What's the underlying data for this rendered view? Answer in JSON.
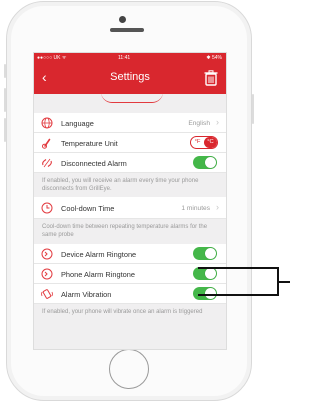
{
  "status": {
    "carrier": "●●○○○ UK  ᯤ",
    "time": "11:41",
    "battery": "✱ 54%"
  },
  "nav": {
    "title": "Settings",
    "back_icon": "chevron-left-icon",
    "action_icon": "trash-icon"
  },
  "settings": {
    "language": {
      "label": "Language",
      "value": "English"
    },
    "temperature_unit": {
      "label": "Temperature Unit",
      "options": [
        "°F",
        "°C"
      ],
      "selected": "°C"
    },
    "disconnected_alarm": {
      "label": "Disconnected Alarm",
      "on": true
    },
    "disconnected_note": "If enabled, you will receive an alarm every time your phone disconnects from GrillEye.",
    "cooldown": {
      "label": "Cool-down Time",
      "value": "1 minutes"
    },
    "cooldown_note": "Cool-down time between repeating temperature alarms for the same probe",
    "device_ringtone": {
      "label": "Device Alarm Ringtone",
      "on": true
    },
    "phone_ringtone": {
      "label": "Phone Alarm Ringtone",
      "on": true
    },
    "vibration": {
      "label": "Alarm Vibration",
      "on": true
    },
    "vibration_note": "If enabled, your phone will vibrate once an alarm is triggered"
  },
  "colors": {
    "accent": "#d9272e",
    "toggle_on": "#44b749"
  }
}
